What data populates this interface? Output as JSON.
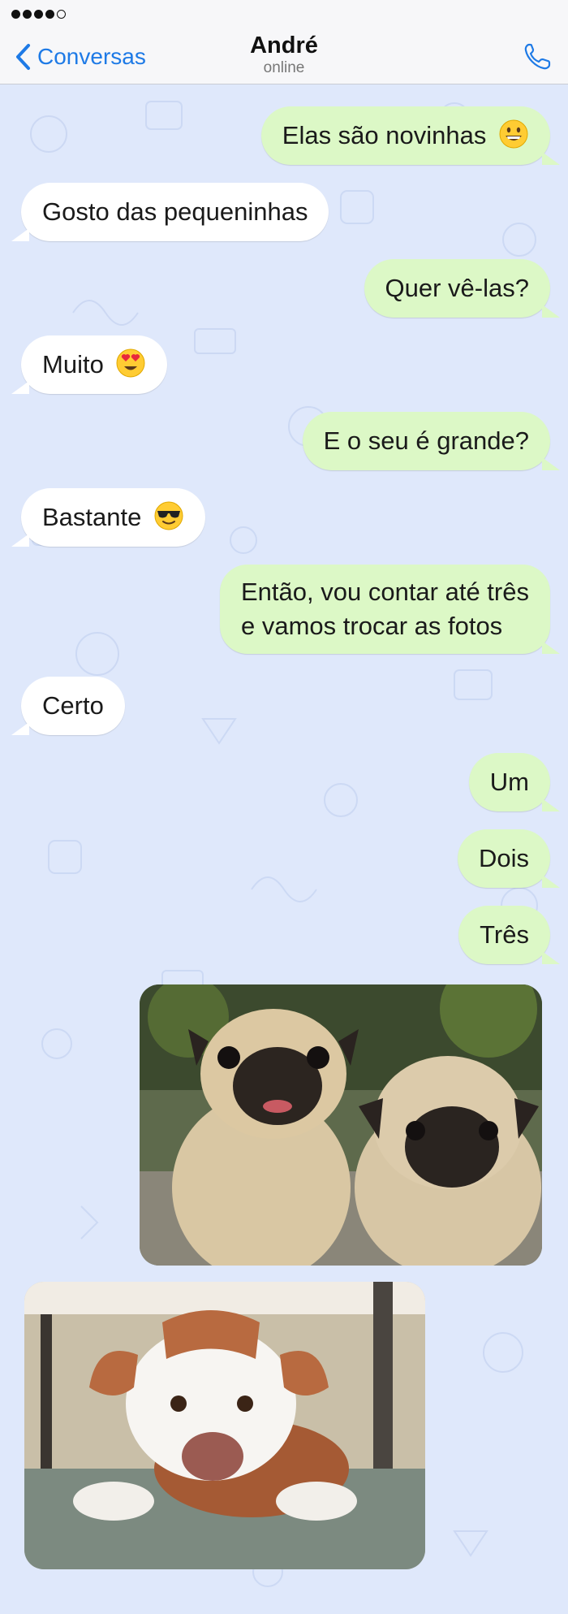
{
  "status": {
    "signal_filled": 4,
    "signal_total": 5
  },
  "header": {
    "back_label": "Conversas",
    "contact_name": "André",
    "contact_status": "online",
    "back_icon": "chevron-left-icon",
    "call_icon": "phone-icon"
  },
  "colors": {
    "accent": "#1e7ae6",
    "outgoing_bubble": "#dcf8c6",
    "incoming_bubble": "#ffffff",
    "chat_background": "#dfe8fb"
  },
  "messages": [
    {
      "direction": "out",
      "text": "Elas são novinhas",
      "emoji": "grinning-face"
    },
    {
      "direction": "in",
      "text": "Gosto das pequeninhas"
    },
    {
      "direction": "out",
      "text": "Quer vê-las?"
    },
    {
      "direction": "in",
      "text": "Muito",
      "emoji": "heart-eyes-face"
    },
    {
      "direction": "out",
      "text": "E o seu é grande?"
    },
    {
      "direction": "in",
      "text": "Bastante",
      "emoji": "sunglasses-face"
    },
    {
      "direction": "out",
      "line1": "Então, vou contar até três",
      "line2": "e vamos trocar as fotos"
    },
    {
      "direction": "in",
      "text": "Certo"
    },
    {
      "direction": "out",
      "text": "Um"
    },
    {
      "direction": "out",
      "text": "Dois"
    },
    {
      "direction": "out",
      "text": "Três"
    },
    {
      "direction": "out",
      "image": "two-pug-puppies-photo"
    },
    {
      "direction": "in",
      "image": "pitbull-dog-lying-down-photo"
    }
  ]
}
